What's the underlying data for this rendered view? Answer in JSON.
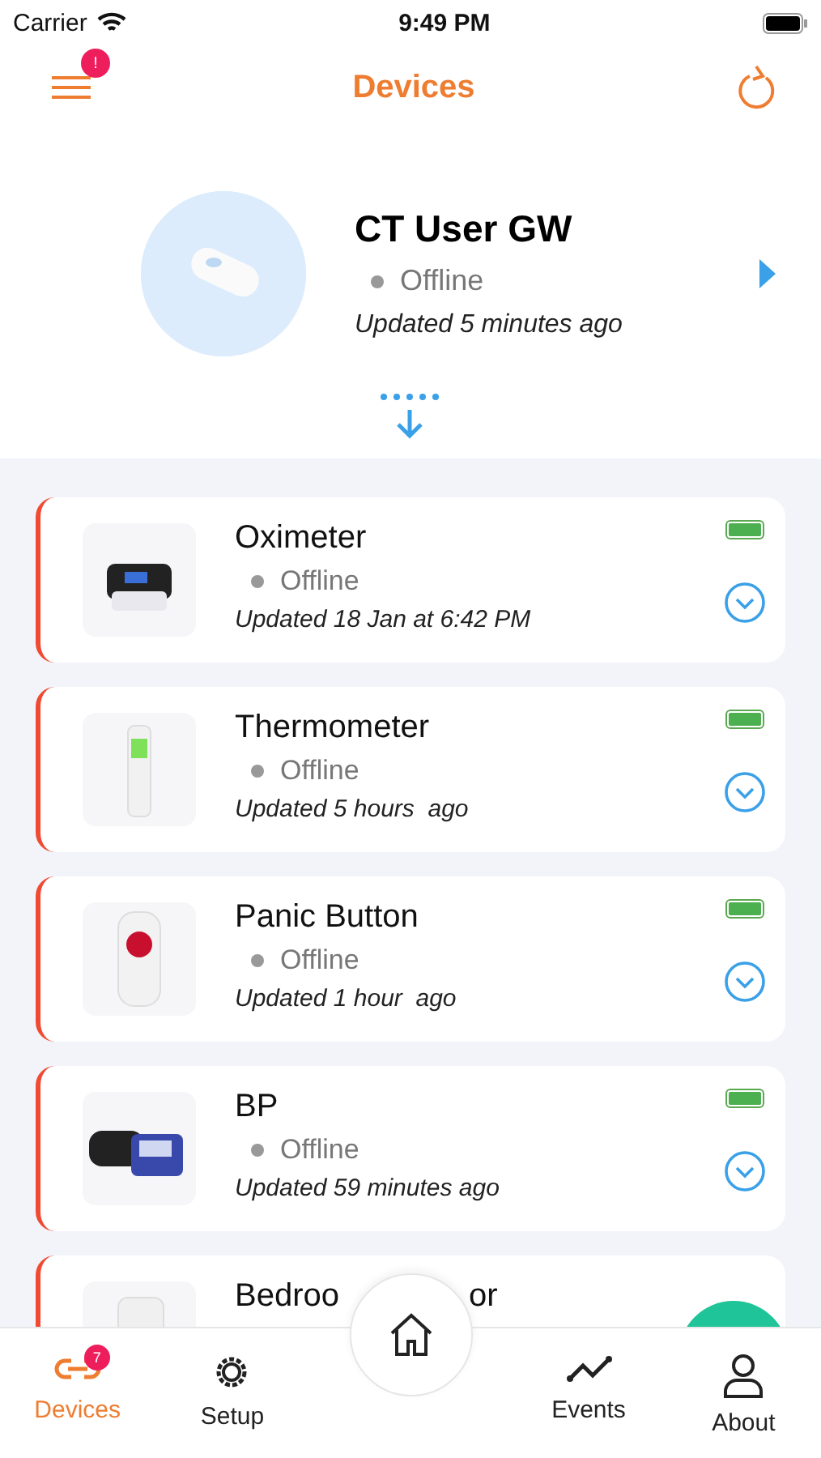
{
  "status_bar": {
    "carrier": "Carrier",
    "time": "9:49 PM"
  },
  "header": {
    "title": "Devices",
    "menu_badge": "!"
  },
  "gateway": {
    "name": "CT User GW",
    "status": "Offline",
    "updated": "Updated 5 minutes ago"
  },
  "devices": [
    {
      "name": "Oximeter",
      "status": "Offline",
      "updated": "Updated 18 Jan at 6:42 PM",
      "battery": {
        "level": 1
      }
    },
    {
      "name": "Thermometer",
      "status": "Offline",
      "updated": "Updated 5 hours  ago",
      "battery": {
        "level": 1
      }
    },
    {
      "name": "Panic Button",
      "status": "Offline",
      "updated": "Updated 1 hour  ago",
      "battery": {
        "level": 1
      }
    },
    {
      "name": "BP",
      "status": "Offline",
      "updated": "Updated 59 minutes ago",
      "battery": {
        "level": 1
      }
    },
    {
      "name": "Bedroo",
      "name_tail": "or"
    }
  ],
  "tabs": [
    {
      "label": "Devices",
      "selected": true,
      "badge": "7"
    },
    {
      "label": "Setup",
      "selected": false
    },
    {
      "label": "Events",
      "selected": false
    },
    {
      "label": "About",
      "selected": false
    }
  ]
}
